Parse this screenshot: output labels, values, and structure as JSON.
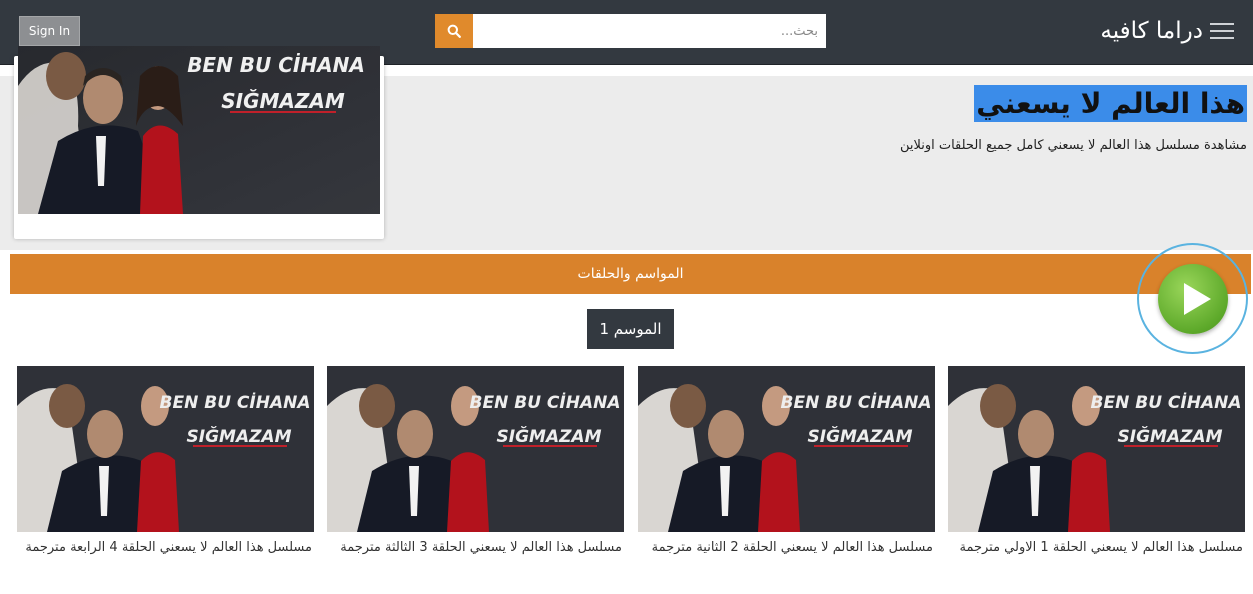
{
  "header": {
    "site_name": "دراما كافيه",
    "search_placeholder": "بحث...",
    "signin_label": "Sign In"
  },
  "hero": {
    "title": "هذا العالم لا يسعني",
    "description": "مشاهدة مسلسل هذا العالم لا يسعني كامل جميع الحلقات اونلاين",
    "poster_text_line1": "BEN BU CİHANA",
    "poster_text_line2": "SIĞMAZAM"
  },
  "seasons": {
    "section_label": "المواسم والحلقات",
    "tabs": [
      "الموسم 1"
    ]
  },
  "episodes": [
    {
      "title": "مسلسل هذا العالم لا يسعني الحلقة 1 الاولي مترجمة"
    },
    {
      "title": "مسلسل هذا العالم لا يسعني الحلقة 2 الثانية مترجمة"
    },
    {
      "title": "مسلسل هذا العالم لا يسعني الحلقة 3 الثالثة مترجمة"
    },
    {
      "title": "مسلسل هذا العالم لا يسعني الحلقة 4 الرابعة مترجمة"
    }
  ],
  "colors": {
    "header_bg": "#333940",
    "accent_orange": "#d9822b",
    "search_button": "#e08a2c",
    "title_highlight": "#3b8ce9",
    "play_green": "#5da92a"
  },
  "icons": [
    "menu-icon",
    "search-icon",
    "play-icon"
  ]
}
